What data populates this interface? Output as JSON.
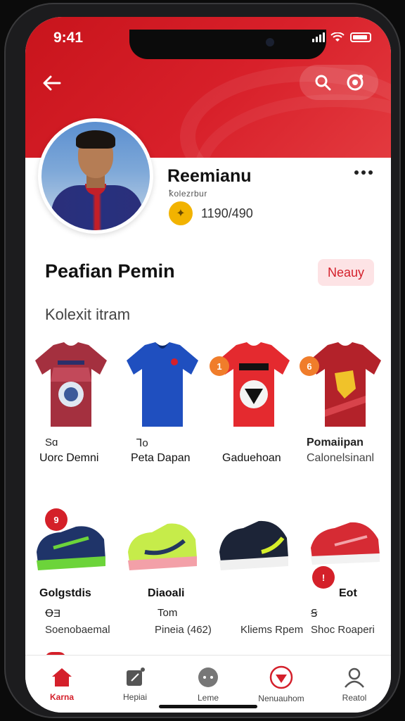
{
  "status_bar": {
    "time": "9:41"
  },
  "header": {
    "back_icon": "arrow-left-icon",
    "search_icon": "search-icon",
    "camera_icon": "camera-icon",
    "brand_color": "#d4202b"
  },
  "profile": {
    "name": "Reemianu",
    "handle": "ꝁolezrbur",
    "points_icon": "coin-icon",
    "points": "1190/490",
    "more_icon": "more-dots-icon"
  },
  "section": {
    "title": "Peafian Pemin",
    "badge": "Neauy",
    "subtitle": "Kolexit itram"
  },
  "jerseys": [
    {
      "tag": "Sɑ",
      "name": "Uorc Demni",
      "badge": ""
    },
    {
      "tag": "Ꞁo",
      "name": "Peta Dapan",
      "badge": ""
    },
    {
      "tag": "",
      "name": "Gaduehoan",
      "badge": "1"
    },
    {
      "tag": "Pomaiipan",
      "name": "Calonelsinanl",
      "badge": "6"
    }
  ],
  "shoes": [
    {
      "name": "Golgstdis",
      "tag": "ꝊƎ",
      "sub": "Soenobaemal",
      "badge": "9"
    },
    {
      "name": "Diaoali",
      "tag": "Tom",
      "sub": "Pineia (462)",
      "badge": ""
    },
    {
      "name": "",
      "tag": "",
      "sub": "Kliems Rpem",
      "badge": ""
    },
    {
      "name": "Eot",
      "tag": "Ꞩ",
      "sub": "Shoc Roaperi",
      "badge": "!"
    }
  ],
  "bottom_nav": [
    {
      "label": "Karna",
      "icon": "home-icon",
      "active": true
    },
    {
      "label": "Hepiai",
      "icon": "edit-icon",
      "active": false
    },
    {
      "label": "Leme",
      "icon": "chat-icon",
      "active": false
    },
    {
      "label": "Nenuauhom",
      "icon": "badge-icon",
      "active": false
    },
    {
      "label": "Reatol",
      "icon": "profile-icon",
      "active": false
    }
  ]
}
